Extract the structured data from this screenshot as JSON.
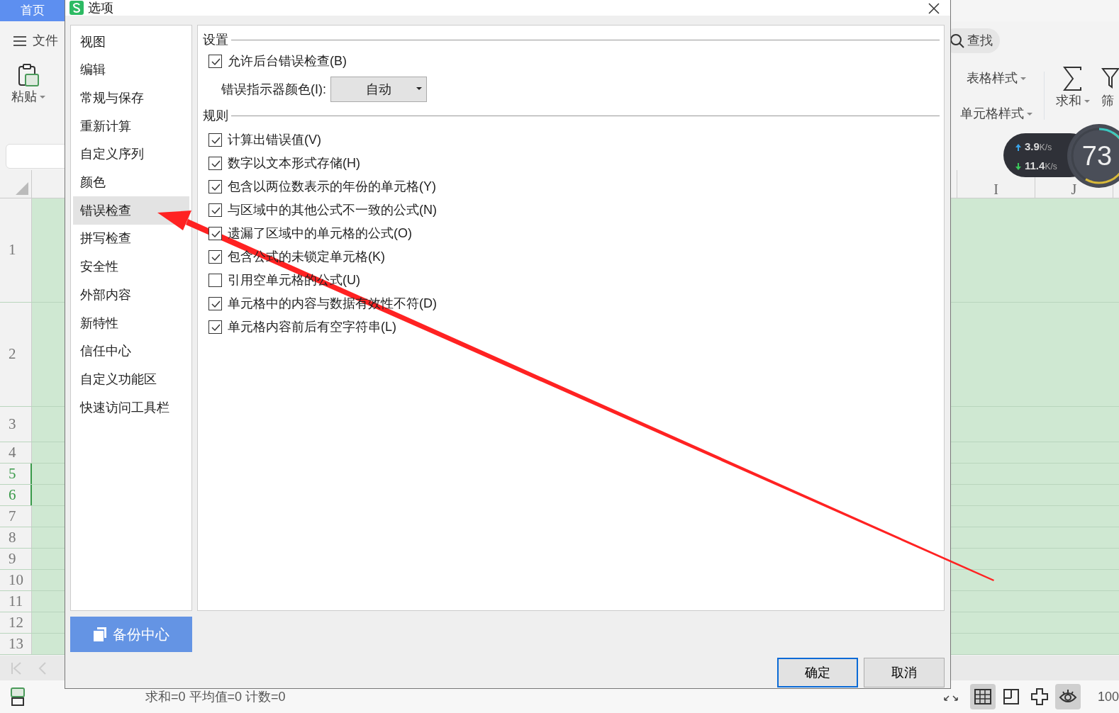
{
  "app": {
    "tabs": [
      {
        "label": "首页",
        "selected": true
      }
    ],
    "menu": "文件",
    "paste": "粘贴",
    "search": "查找",
    "styles": [
      "表格样式",
      "单元格样式"
    ],
    "sum_button": "求和",
    "filter_button": "筛",
    "columns": [
      "I",
      "J"
    ],
    "rows": [
      {
        "label": "1",
        "selected": false
      },
      {
        "label": "2",
        "selected": false
      },
      {
        "label": "3",
        "selected": false
      },
      {
        "label": "4",
        "selected": false
      },
      {
        "label": "5",
        "selected": true
      },
      {
        "label": "6",
        "selected": true
      },
      {
        "label": "7",
        "selected": false
      },
      {
        "label": "8",
        "selected": false
      },
      {
        "label": "9",
        "selected": false
      },
      {
        "label": "10",
        "selected": false
      },
      {
        "label": "11",
        "selected": false
      },
      {
        "label": "12",
        "selected": false
      },
      {
        "label": "13",
        "selected": false
      }
    ],
    "network": {
      "upload": "3.9",
      "upload_unit": "K/s",
      "download": "11.4",
      "download_unit": "K/s",
      "percent": "73"
    },
    "status_bar": {
      "summary": "求和=0  平均值=0  计数=0",
      "zoom": "100",
      "view_buttons": [
        {
          "kind": "grid",
          "selected": true
        },
        {
          "kind": "page",
          "selected": false
        },
        {
          "kind": "cross",
          "selected": false
        },
        {
          "kind": "eye",
          "selected": true
        }
      ]
    }
  },
  "dialog": {
    "title": "选项",
    "nav": [
      {
        "label": "视图",
        "selected": false
      },
      {
        "label": "编辑",
        "selected": false
      },
      {
        "label": "常规与保存",
        "selected": false
      },
      {
        "label": "重新计算",
        "selected": false
      },
      {
        "label": "自定义序列",
        "selected": false
      },
      {
        "label": "颜色",
        "selected": false
      },
      {
        "label": "错误检查",
        "selected": true
      },
      {
        "label": "拼写检查",
        "selected": false
      },
      {
        "label": "安全性",
        "selected": false
      },
      {
        "label": "外部内容",
        "selected": false
      },
      {
        "label": "新特性",
        "selected": false
      },
      {
        "label": "信任中心",
        "selected": false
      },
      {
        "label": "自定义功能区",
        "selected": false
      },
      {
        "label": "快速访问工具栏",
        "selected": false
      }
    ],
    "backup_button": "备份中心",
    "settings": {
      "heading": "设置",
      "background_check": {
        "label": "允许后台错误检查(B)",
        "checked": true
      },
      "indicator_color": {
        "label": "错误指示器颜色(I):",
        "value": "自动"
      }
    },
    "rules": {
      "heading": "规则",
      "items": [
        {
          "label": "计算出错误值(V)",
          "checked": true
        },
        {
          "label": "数字以文本形式存储(H)",
          "checked": true
        },
        {
          "label": "包含以两位数表示的年份的单元格(Y)",
          "checked": true
        },
        {
          "label": "与区域中的其他公式不一致的公式(N)",
          "checked": true
        },
        {
          "label": "遗漏了区域中的单元格的公式(O)",
          "checked": true
        },
        {
          "label": "包含公式的未锁定单元格(K)",
          "checked": true
        },
        {
          "label": "引用空单元格的公式(U)",
          "checked": false
        },
        {
          "label": "单元格中的内容与数据有效性不符(D)",
          "checked": true
        },
        {
          "label": "单元格内容前后有空字符串(L)",
          "checked": true
        }
      ]
    },
    "buttons": [
      {
        "label": "确定",
        "selected": true
      },
      {
        "label": "取消",
        "selected": false
      }
    ]
  }
}
